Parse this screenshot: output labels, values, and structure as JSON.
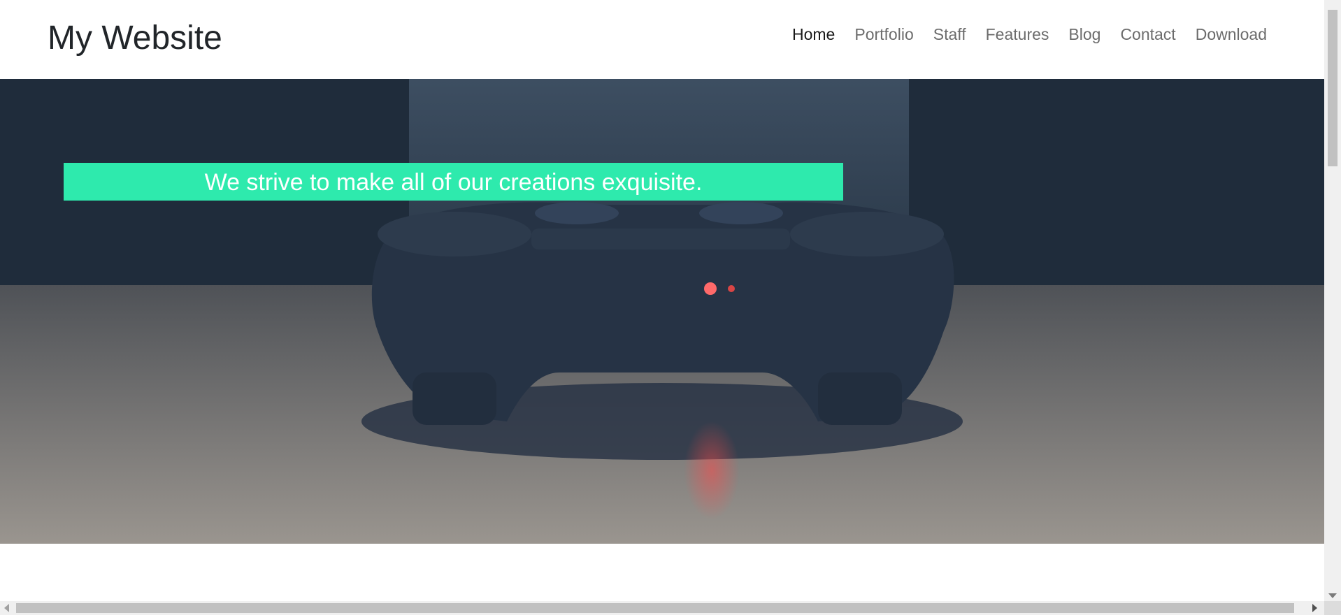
{
  "brand": {
    "title": "My Website"
  },
  "nav": {
    "items": [
      {
        "label": "Home",
        "active": true
      },
      {
        "label": "Portfolio"
      },
      {
        "label": "Staff"
      },
      {
        "label": "Features"
      },
      {
        "label": "Blog"
      },
      {
        "label": "Contact"
      },
      {
        "label": "Download"
      }
    ]
  },
  "hero": {
    "tagline": "We strive to make all of our creations exquisite.",
    "image": "game-controller-photo",
    "banner_color": "#2eeaad"
  }
}
